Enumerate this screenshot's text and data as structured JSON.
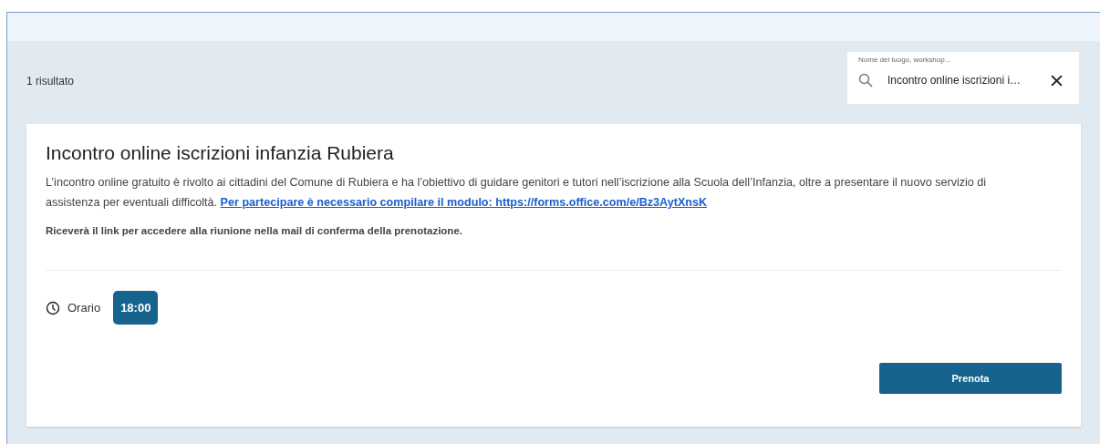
{
  "results_count": "1 risultato",
  "search": {
    "label": "Nome del luogo, workshop...",
    "value": "Incontro online iscrizioni i…"
  },
  "event": {
    "title": "Incontro online iscrizioni infanzia Rubiera",
    "description": "L’incontro online gratuito è rivolto ai cittadini del Comune di Rubiera e ha l’obiettivo di guidare genitori e tutori nell’iscrizione alla Scuola dell’Infanzia, oltre a presentare il nuovo servizio di assistenza per eventuali difficoltà.",
    "link": "Per partecipare è necessario compilare il modulo: https://forms.office.com/e/Bz3AytXnsK",
    "note": "Riceverà il link per accedere alla riunione nella mail di conferma della prenotazione.",
    "time_label": "Orario",
    "times": [
      {
        "label": "18:00",
        "selected": true
      }
    ],
    "button": "Prenota"
  }
}
